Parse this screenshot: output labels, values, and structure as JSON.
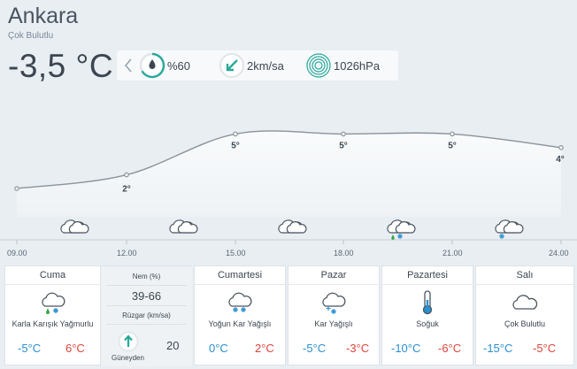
{
  "location": {
    "city": "Ankara",
    "condition": "Çok Bulutlu"
  },
  "current": {
    "temperature": "-3,5 °C",
    "humidity": "%60",
    "wind": "2km/sa",
    "pressure": "1026hPa"
  },
  "hourly": {
    "times": [
      "09.00",
      "12.00",
      "15.00",
      "18.00",
      "21.00",
      "24.00"
    ],
    "temp_labels": [
      "2°",
      "5°",
      "5°",
      "5°",
      "4°"
    ],
    "temps": [
      1,
      2,
      5,
      5,
      5,
      4
    ],
    "icons": [
      "cloud-icon",
      "cloud-icon",
      "cloud-icon",
      "cloud-icon",
      "rain-snow-cloud-icon",
      "snow-cloud-icon"
    ]
  },
  "days": [
    {
      "name": "Cuma",
      "condition": "Karla Karışık Yağmurlu",
      "icon": "rain-snow-cloud-icon",
      "low": "-5°C",
      "high": "6°C",
      "details": {
        "humidity_label": "Nem (%)",
        "humidity_value": "39-66",
        "wind_label": "Rüzgar (km/sa)",
        "wind_dir": "Güneyden",
        "wind_value": "20"
      }
    },
    {
      "name": "Cumartesi",
      "condition": "Yoğun Kar Yağışlı",
      "icon": "heavy-snow-cloud-icon",
      "low": "0°C",
      "high": "2°C"
    },
    {
      "name": "Pazar",
      "condition": "Kar Yağışlı",
      "icon": "snow-cloud-icon",
      "low": "-5°C",
      "high": "-3°C"
    },
    {
      "name": "Pazartesi",
      "condition": "Soğuk",
      "icon": "thermometer-icon",
      "low": "-10°C",
      "high": "-6°C"
    },
    {
      "name": "Salı",
      "condition": "Çok Bulutlu",
      "icon": "cloud-icon",
      "low": "-15°C",
      "high": "-5°C"
    }
  ],
  "colors": {
    "accent": "#2aa89a",
    "low": "#2b8fd1",
    "high": "#e0453a",
    "curve": "#8a939c"
  }
}
